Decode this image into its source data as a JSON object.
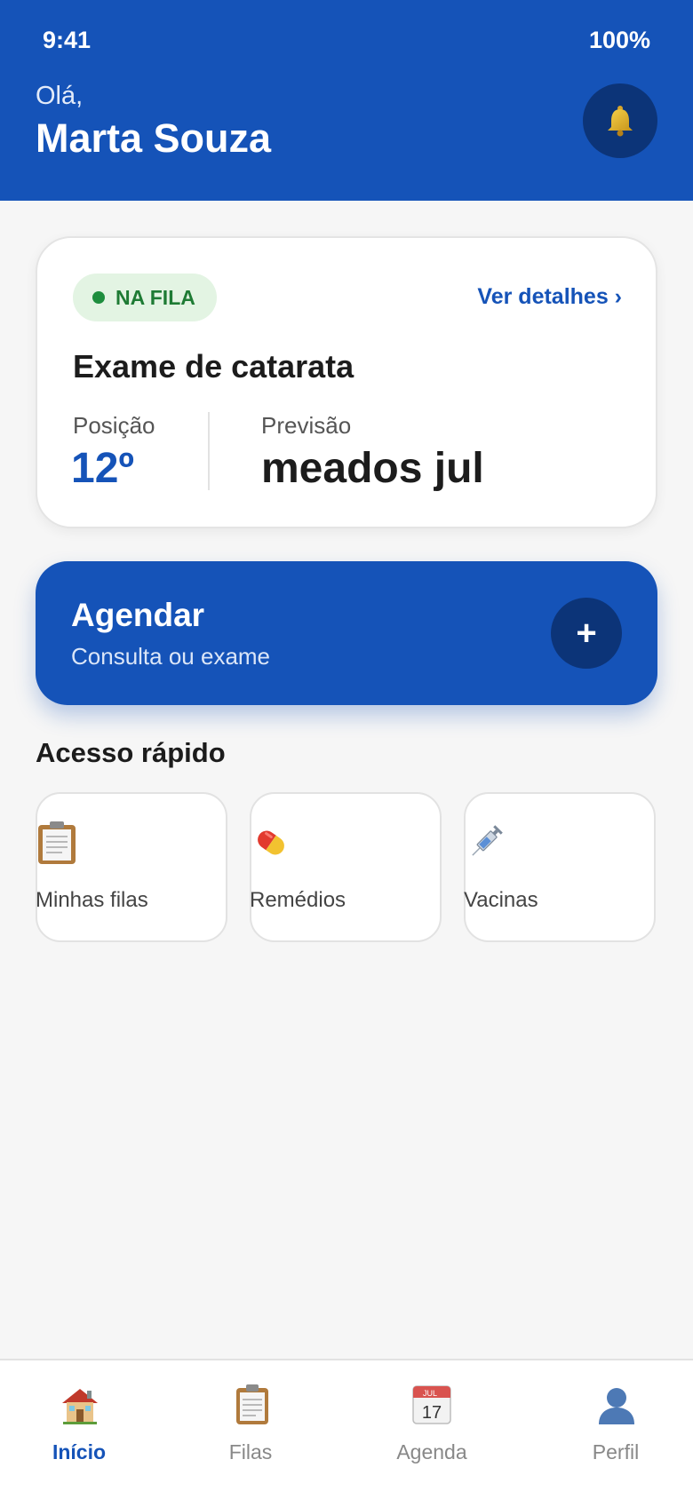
{
  "status_bar": {
    "time": "9:41",
    "battery": "100%"
  },
  "header": {
    "greeting": "Olá,",
    "user_name": "Marta Souza",
    "notification_icon": "bell-icon"
  },
  "queue_card": {
    "status_label": "NA FILA",
    "details_link": "Ver detalhes ›",
    "exam_title": "Exame de catarata",
    "position_label": "Posição",
    "position_value": "12º",
    "forecast_label": "Previsão",
    "forecast_value": "meados jul"
  },
  "schedule": {
    "title": "Agendar",
    "subtitle": "Consulta ou exame",
    "action_symbol": "+"
  },
  "quick_access": {
    "title": "Acesso rápido",
    "items": [
      {
        "label": "Minhas filas",
        "icon": "clipboard-icon"
      },
      {
        "label": "Remédios",
        "icon": "pill-icon"
      },
      {
        "label": "Vacinas",
        "icon": "syringe-icon"
      }
    ]
  },
  "bottom_nav": {
    "items": [
      {
        "label": "Início",
        "icon": "house-icon",
        "active": true
      },
      {
        "label": "Filas",
        "icon": "clipboard-icon",
        "active": false
      },
      {
        "label": "Agenda",
        "icon": "calendar-icon",
        "active": false
      },
      {
        "label": "Perfil",
        "icon": "person-icon",
        "active": false
      }
    ],
    "calendar_month": "JUL",
    "calendar_day": "17"
  },
  "colors": {
    "brand": "#1553b8",
    "brand_dark": "#0c3478",
    "status_green": "#1e7b34",
    "status_green_bg": "#e3f4e3",
    "background": "#f6f6f6"
  }
}
